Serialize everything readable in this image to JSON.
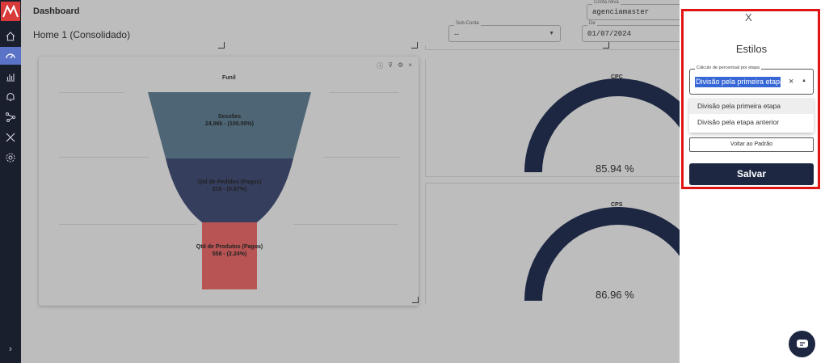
{
  "header": {
    "section_label": "Dashboard",
    "page_title": "Home 1 (Consolidado)"
  },
  "filters": {
    "account": {
      "label": "Conta Ativa",
      "value": "agenciamaster"
    },
    "subaccount": {
      "label": "Sub-Conta",
      "value": "--"
    },
    "from": {
      "label": "De",
      "value": "01/07/2024"
    }
  },
  "funnel_widget": {
    "title": "Funil",
    "tool_icons": [
      "info-icon",
      "filter-icon",
      "settings-icon",
      "close-icon"
    ],
    "stages": [
      {
        "label": "Sessões",
        "value": "24,96k - (100.00%)",
        "color": "#4d6574"
      },
      {
        "label": "Qtd de Pedidos (Pagos)",
        "value": "216 - (0.87%)",
        "color": "#363e5e"
      },
      {
        "label": "Qtd de Produtos (Pagos)",
        "value": "558 - (2.24%)",
        "color": "#b85454"
      }
    ]
  },
  "gauges": [
    {
      "title": "CPC",
      "value": "85.94 %",
      "percent": 85.94
    },
    {
      "title": "CPS",
      "value": "86.96 %",
      "percent": 86.96
    }
  ],
  "styles_panel": {
    "close_label": "X",
    "title": "Estilos",
    "select_label": "Cálculo de percentual por etapa",
    "selected_value": "Divisão pela primeira etapa",
    "clear_label": "×",
    "options": [
      "Divisão pela primeira etapa",
      "Divisão pela etapa anterior"
    ],
    "reset_label": "Voltar ao Padrão",
    "save_label": "Salvar"
  },
  "colors": {
    "sidebar": "#1a1f2e",
    "sidebar_active": "#5b73c7",
    "primary_dark": "#1d2742",
    "highlight": "#e01414",
    "selection": "#3767d6"
  }
}
